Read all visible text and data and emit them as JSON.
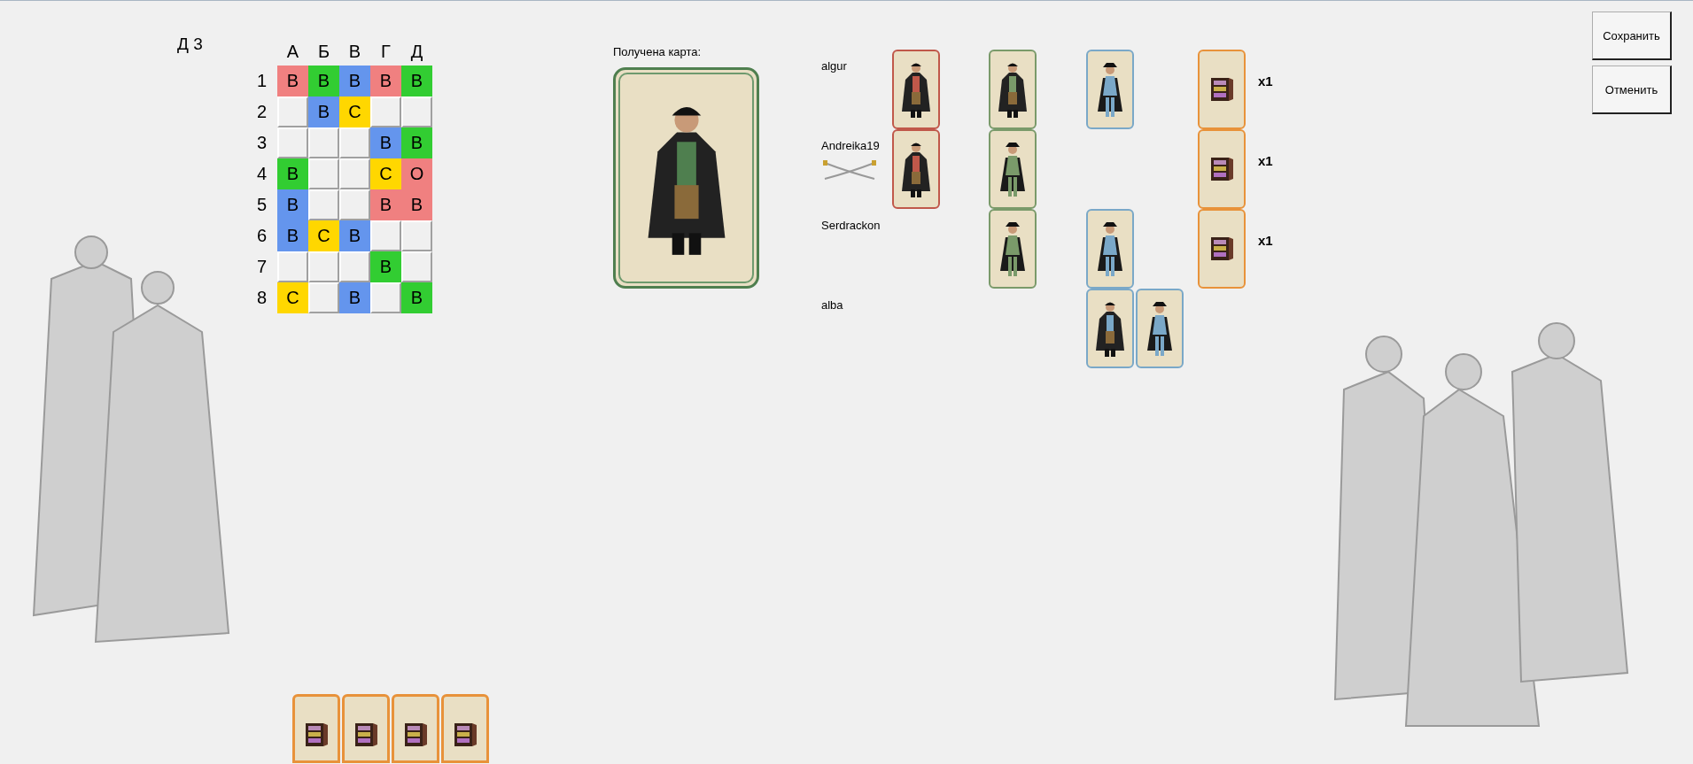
{
  "turn_label": "Д 3",
  "grid": {
    "columns": [
      "А",
      "Б",
      "В",
      "Г",
      "Д"
    ],
    "rows": [
      {
        "label": "1",
        "cells": [
          {
            "filled": true,
            "text": "В",
            "color": "#f08080"
          },
          {
            "filled": true,
            "text": "В",
            "color": "#32cd32"
          },
          {
            "filled": true,
            "text": "В",
            "color": "#6495ed"
          },
          {
            "filled": true,
            "text": "В",
            "color": "#f08080"
          },
          {
            "filled": true,
            "text": "В",
            "color": "#32cd32"
          }
        ]
      },
      {
        "label": "2",
        "cells": [
          {
            "filled": false
          },
          {
            "filled": true,
            "text": "В",
            "color": "#6495ed"
          },
          {
            "filled": true,
            "text": "С",
            "color": "#ffd700"
          },
          {
            "filled": false
          },
          {
            "filled": false
          }
        ]
      },
      {
        "label": "3",
        "cells": [
          {
            "filled": false
          },
          {
            "filled": false
          },
          {
            "filled": false
          },
          {
            "filled": true,
            "text": "В",
            "color": "#6495ed"
          },
          {
            "filled": true,
            "text": "В",
            "color": "#32cd32"
          }
        ]
      },
      {
        "label": "4",
        "cells": [
          {
            "filled": true,
            "text": "В",
            "color": "#32cd32"
          },
          {
            "filled": false
          },
          {
            "filled": false
          },
          {
            "filled": true,
            "text": "С",
            "color": "#ffd700"
          },
          {
            "filled": true,
            "text": "О",
            "color": "#f08080"
          }
        ]
      },
      {
        "label": "5",
        "cells": [
          {
            "filled": true,
            "text": "В",
            "color": "#6495ed"
          },
          {
            "filled": false
          },
          {
            "filled": false
          },
          {
            "filled": true,
            "text": "В",
            "color": "#f08080"
          },
          {
            "filled": true,
            "text": "В",
            "color": "#f08080"
          }
        ]
      },
      {
        "label": "6",
        "cells": [
          {
            "filled": true,
            "text": "В",
            "color": "#6495ed"
          },
          {
            "filled": true,
            "text": "С",
            "color": "#ffd700"
          },
          {
            "filled": true,
            "text": "В",
            "color": "#6495ed"
          },
          {
            "filled": false
          },
          {
            "filled": false
          }
        ]
      },
      {
        "label": "7",
        "cells": [
          {
            "filled": false
          },
          {
            "filled": false
          },
          {
            "filled": false
          },
          {
            "filled": true,
            "text": "В",
            "color": "#32cd32"
          },
          {
            "filled": false
          }
        ]
      },
      {
        "label": "8",
        "cells": [
          {
            "filled": true,
            "text": "С",
            "color": "#ffd700"
          },
          {
            "filled": false
          },
          {
            "filled": true,
            "text": "В",
            "color": "#6495ed"
          },
          {
            "filled": false
          },
          {
            "filled": true,
            "text": "В",
            "color": "#32cd32"
          }
        ]
      }
    ]
  },
  "hand": [
    {
      "kind": "chest",
      "color": "#e8923a"
    },
    {
      "kind": "chest",
      "color": "#e8923a"
    },
    {
      "kind": "chest",
      "color": "#e8923a"
    },
    {
      "kind": "chest",
      "color": "#e8923a"
    }
  ],
  "received": {
    "label": "Получена карта:",
    "card": {
      "kind": "captain",
      "color": "#4f7f4f"
    }
  },
  "players": [
    {
      "name": "algur",
      "turn": false,
      "chest_count": "x1",
      "red": [
        {
          "kind": "captain",
          "color": "#c0584a"
        }
      ],
      "green": [
        {
          "kind": "captain",
          "color": "#7a9a6a"
        }
      ],
      "blue": [
        {
          "kind": "lady",
          "color": "#7aa8c8"
        }
      ],
      "chest": [
        {
          "kind": "chest",
          "color": "#e8923a"
        }
      ]
    },
    {
      "name": "Andreika19",
      "turn": true,
      "chest_count": "x1",
      "red": [
        {
          "kind": "captain",
          "color": "#c0584a"
        }
      ],
      "green": [
        {
          "kind": "lady",
          "color": "#7a9a6a"
        }
      ],
      "chest": [
        {
          "kind": "chest",
          "color": "#e8923a"
        }
      ]
    },
    {
      "name": "Serdrackon",
      "turn": false,
      "chest_count": "x1",
      "green": [
        {
          "kind": "lady",
          "color": "#7a9a6a"
        }
      ],
      "blue": [
        {
          "kind": "lady",
          "color": "#7aa8c8"
        }
      ],
      "chest": [
        {
          "kind": "chest",
          "color": "#e8923a"
        }
      ]
    },
    {
      "name": "alba",
      "turn": false,
      "blue": [
        {
          "kind": "captain",
          "color": "#7aa8c8"
        },
        {
          "kind": "lady",
          "color": "#7aa8c8"
        }
      ]
    }
  ],
  "buttons": [
    {
      "label": "Сохранить"
    },
    {
      "label": "Отменить"
    }
  ]
}
